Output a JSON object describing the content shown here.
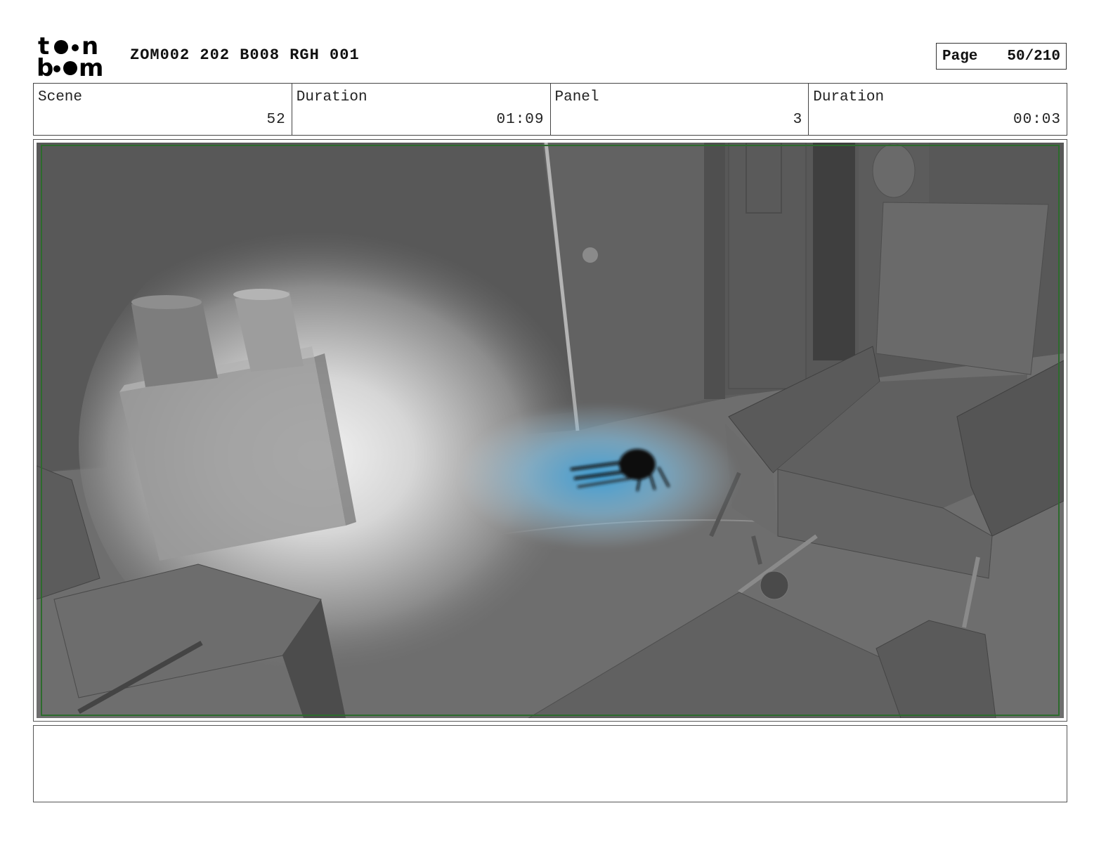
{
  "header": {
    "logo": "toon boom",
    "title": "ZOM002 202 B008 RGH 001",
    "page_label": "Page",
    "page_number": "50/210"
  },
  "info": {
    "scene_label": "Scene",
    "scene_value": "52",
    "scene_duration_label": "Duration",
    "scene_duration_value": "01:09",
    "panel_label": "Panel",
    "panel_value": "3",
    "panel_duration_label": "Duration",
    "panel_duration_value": "00:03"
  },
  "notes": {
    "text": ""
  }
}
